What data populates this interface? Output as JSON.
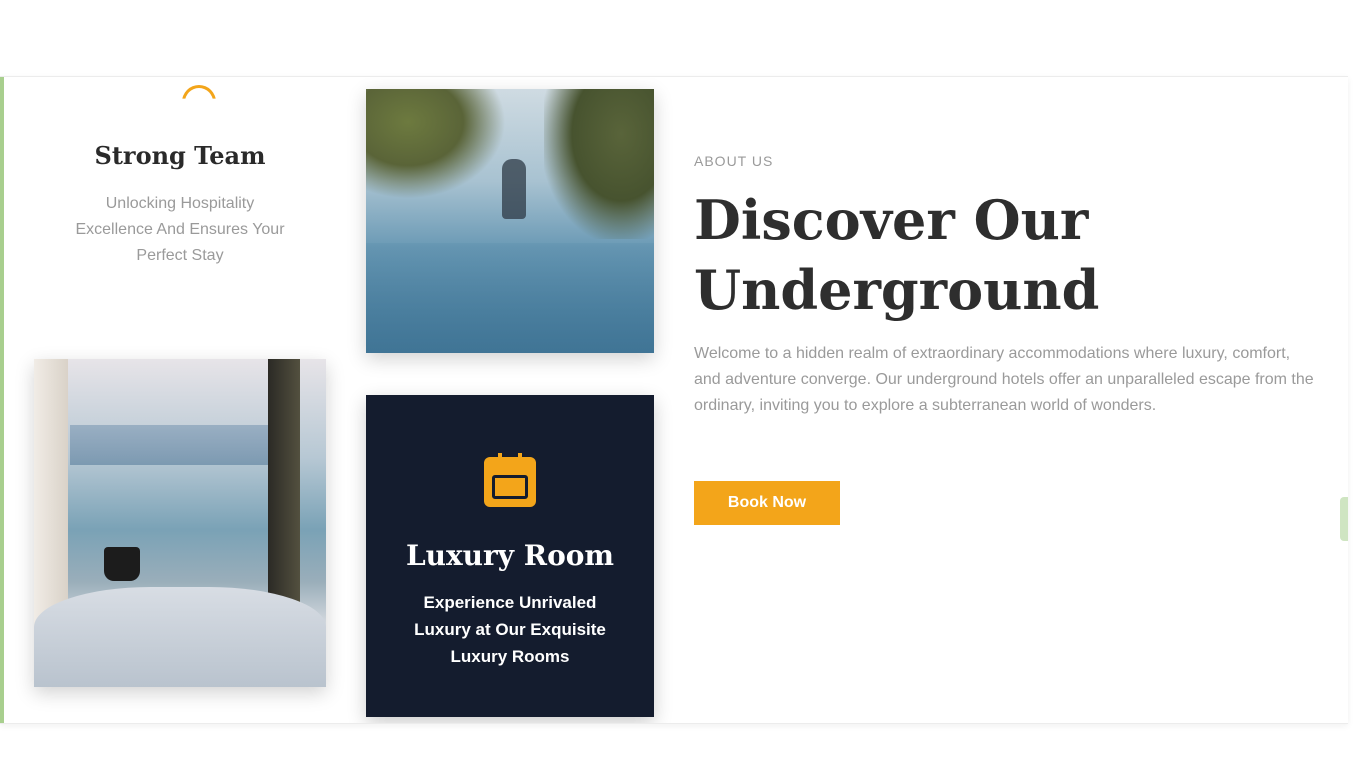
{
  "feature": {
    "icon": "arc-icon",
    "title": "Strong Team",
    "text": "Unlocking Hospitality Excellence And Ensures Your Perfect Stay"
  },
  "images": {
    "lake": "lake-photo",
    "room": "room-view-photo"
  },
  "luxury_card": {
    "icon": "calendar-icon",
    "title": "Luxury Room",
    "text": "Experience Unrivaled Luxury at Our Exquisite Luxury Rooms"
  },
  "about": {
    "label": "ABOUT US",
    "heading": "Discover Our Underground",
    "body": "Welcome to a hidden realm of extraordinary accommodations where luxury, comfort, and adventure converge. Our underground hotels offer an unparalleled escape from the ordinary, inviting you to explore a subterranean world of wonders.",
    "button_label": "Book Now"
  },
  "colors": {
    "accent": "#f3a51a",
    "card_dark": "#141c2e",
    "muted_text": "#9a9a9a"
  }
}
